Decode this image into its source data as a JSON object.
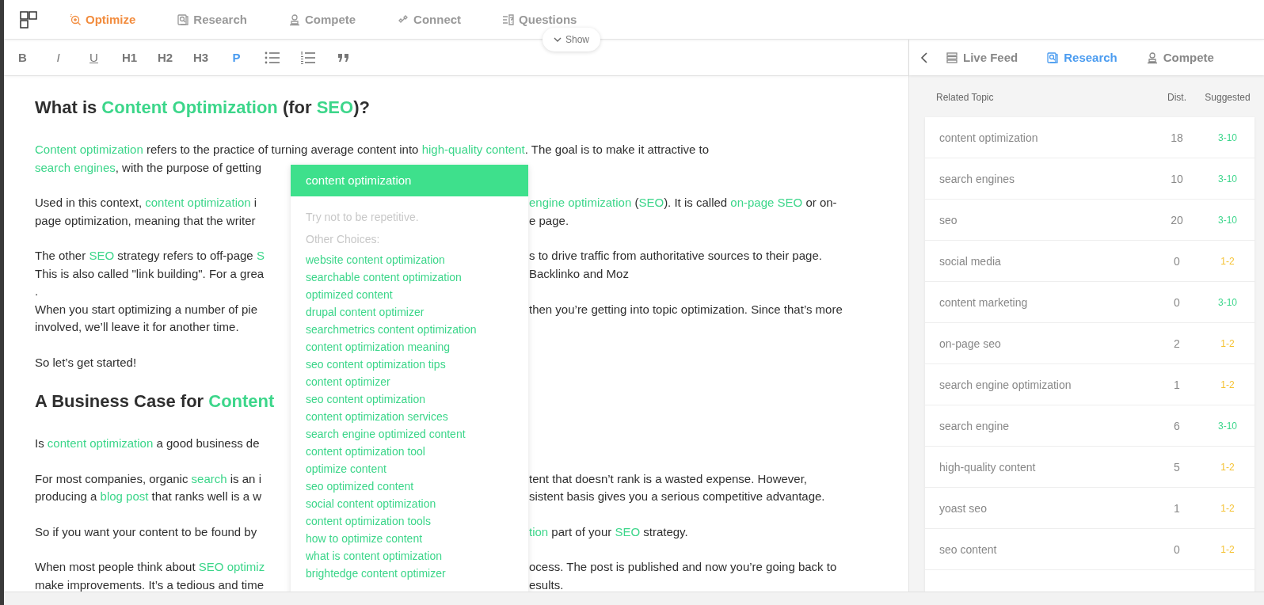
{
  "nav": {
    "tabs": [
      {
        "label": "Optimize",
        "selected": true
      },
      {
        "label": "Research",
        "selected": false
      },
      {
        "label": "Compete",
        "selected": false
      },
      {
        "label": "Connect",
        "selected": false
      },
      {
        "label": "Questions",
        "selected": false
      }
    ],
    "show_button": "Show"
  },
  "toolbar": [
    {
      "kind": "text",
      "label": "B",
      "selected": false
    },
    {
      "kind": "text",
      "label": "I",
      "selected": false
    },
    {
      "kind": "text",
      "label": "U",
      "selected": false
    },
    {
      "kind": "text",
      "label": "H1",
      "selected": false
    },
    {
      "kind": "text",
      "label": "H2",
      "selected": false
    },
    {
      "kind": "text",
      "label": "H3",
      "selected": false
    },
    {
      "kind": "text",
      "label": "P",
      "selected": true
    },
    {
      "kind": "bullets",
      "selected": false
    },
    {
      "kind": "numbers",
      "selected": false
    },
    {
      "kind": "quote",
      "selected": false
    }
  ],
  "editor": {
    "paragraphs": [
      {
        "kind": "heading",
        "lines": [
          {
            "left": [
              {
                "text": "What is ",
                "keyword": false
              },
              {
                "text": "Content Optimization",
                "keyword": true
              },
              {
                "text": " (for ",
                "keyword": false
              },
              {
                "text": "SEO",
                "keyword": true
              },
              {
                "text": ")?",
                "keyword": false
              }
            ]
          }
        ]
      },
      {
        "kind": "text",
        "lines": [
          {
            "left": [
              {
                "text": "Content optimization",
                "keyword": true
              },
              {
                "text": " refers to the practice of turning average content into ",
                "keyword": false
              },
              {
                "text": "high-quality content",
                "keyword": true
              },
              {
                "text": ". The goal is to make it attractive to",
                "keyword": false
              }
            ]
          },
          {
            "left": [
              {
                "text": "search engines",
                "keyword": true
              },
              {
                "text": ", with the purpose of getting",
                "keyword": false
              }
            ]
          }
        ]
      },
      {
        "kind": "text",
        "lines": [
          {
            "left": [
              {
                "text": "Used in this context, ",
                "keyword": false
              },
              {
                "text": "content optimization",
                "keyword": true
              },
              {
                "text": " i",
                "keyword": false
              }
            ],
            "right": [
              {
                "text": "engine optimization",
                "keyword": true
              },
              {
                "text": " (",
                "keyword": false
              },
              {
                "text": "SEO",
                "keyword": true
              },
              {
                "text": "). It is called ",
                "keyword": false
              },
              {
                "text": "on-page SEO",
                "keyword": true
              },
              {
                "text": " or on-",
                "keyword": false
              }
            ]
          },
          {
            "left": [
              {
                "text": "page optimization, meaning that the writer",
                "keyword": false
              }
            ],
            "right": [
              {
                "text": "e page.",
                "keyword": false
              }
            ]
          }
        ]
      },
      {
        "kind": "text",
        "lines": [
          {
            "left": [
              {
                "text": "The other ",
                "keyword": false
              },
              {
                "text": "SEO",
                "keyword": true
              },
              {
                "text": " strategy refers to off-page ",
                "keyword": false
              },
              {
                "text": "S",
                "keyword": true
              }
            ],
            "right": [
              {
                "text": "s to drive traffic from authoritative sources to their page.",
                "keyword": false
              }
            ]
          },
          {
            "left": [
              {
                "text": "This is also called \"link building\". For a grea",
                "keyword": false
              }
            ],
            "right": [
              {
                "text": "Backlinko and Moz",
                "keyword": false
              }
            ]
          },
          {
            "left": [
              {
                "text": ".",
                "keyword": false
              }
            ]
          },
          {
            "left": [
              {
                "text": "When you start optimizing a number of pie",
                "keyword": false
              }
            ],
            "right": [
              {
                "text": "then you’re getting into topic optimization. Since that’s more",
                "keyword": false
              }
            ]
          },
          {
            "left": [
              {
                "text": "involved, we’ll leave it for another time.",
                "keyword": false
              }
            ]
          }
        ]
      },
      {
        "kind": "text",
        "lines": [
          {
            "left": [
              {
                "text": "So let’s get started!",
                "keyword": false
              }
            ]
          }
        ]
      },
      {
        "kind": "heading",
        "lines": [
          {
            "left": [
              {
                "text": "A Business Case for ",
                "keyword": false
              },
              {
                "text": "Content",
                "keyword": true
              }
            ]
          }
        ]
      },
      {
        "kind": "text",
        "lines": [
          {
            "left": [
              {
                "text": "Is ",
                "keyword": false
              },
              {
                "text": "content optimization",
                "keyword": true
              },
              {
                "text": " a good business de",
                "keyword": false
              }
            ]
          }
        ]
      },
      {
        "kind": "text",
        "lines": [
          {
            "left": [
              {
                "text": "For most companies, organic ",
                "keyword": false
              },
              {
                "text": "search",
                "keyword": true
              },
              {
                "text": " is an i",
                "keyword": false
              }
            ],
            "right": [
              {
                "text": "tent that doesn’t rank is a wasted expense. However,",
                "keyword": false
              }
            ]
          },
          {
            "left": [
              {
                "text": "producing a ",
                "keyword": false
              },
              {
                "text": "blog post",
                "keyword": true
              },
              {
                "text": " that ranks well is a w",
                "keyword": false
              }
            ],
            "right": [
              {
                "text": "sistent basis gives you a serious competitive advantage.",
                "keyword": false
              }
            ]
          }
        ]
      },
      {
        "kind": "text",
        "lines": [
          {
            "left": [
              {
                "text": "So if you want your content to be found by",
                "keyword": false
              }
            ],
            "right": [
              {
                "text": "tion",
                "keyword": true
              },
              {
                "text": " part of your ",
                "keyword": false
              },
              {
                "text": "SEO",
                "keyword": true
              },
              {
                "text": " strategy.",
                "keyword": false
              }
            ]
          }
        ]
      },
      {
        "kind": "text",
        "lines": [
          {
            "left": [
              {
                "text": "When most people think about ",
                "keyword": false
              },
              {
                "text": "SEO optimiz",
                "keyword": true
              }
            ],
            "right": [
              {
                "text": "ocess. The post is published and now you’re going back to",
                "keyword": false
              }
            ]
          },
          {
            "left": [
              {
                "text": "make improvements. It’s a tedious and time",
                "keyword": false
              }
            ],
            "right": [
              {
                "text": "esults.",
                "keyword": false
              }
            ]
          }
        ]
      }
    ]
  },
  "popup": {
    "title": "content optimization",
    "hint": "Try not to be repetitive.",
    "choices_label": "Other Choices:",
    "choices": [
      "website content optimization",
      "searchable content optimization",
      "optimized content",
      "drupal content optimizer",
      "searchmetrics content optimization",
      "content optimization meaning",
      "seo content optimization tips",
      "content optimizer",
      "seo content optimization",
      "content optimization services",
      "search engine optimized content",
      "content optimization tool",
      "optimize content",
      "seo optimized content",
      "social content optimization",
      "content optimization tools",
      "how to optimize content",
      "what is content optimization",
      "brightedge content optimizer"
    ]
  },
  "panel": {
    "tabs": [
      {
        "label": "Live Feed",
        "selected": false
      },
      {
        "label": "Research",
        "selected": true
      },
      {
        "label": "Compete",
        "selected": false
      }
    ],
    "columns": [
      "Related Topic",
      "Dist.",
      "Suggested"
    ],
    "rows": [
      {
        "topic": "content optimization",
        "dist": "18",
        "suggested": "3-10",
        "color": "#3dd68c"
      },
      {
        "topic": "search engines",
        "dist": "10",
        "suggested": "3-10",
        "color": "#3dd68c"
      },
      {
        "topic": "seo",
        "dist": "20",
        "suggested": "3-10",
        "color": "#3dd68c"
      },
      {
        "topic": "social media",
        "dist": "0",
        "suggested": "1-2",
        "color": "#f5c232"
      },
      {
        "topic": "content marketing",
        "dist": "0",
        "suggested": "3-10",
        "color": "#3dd68c"
      },
      {
        "topic": "on-page seo",
        "dist": "2",
        "suggested": "1-2",
        "color": "#f5c232"
      },
      {
        "topic": "search engine optimization",
        "dist": "1",
        "suggested": "1-2",
        "color": "#f5c232"
      },
      {
        "topic": "search engine",
        "dist": "6",
        "suggested": "3-10",
        "color": "#3dd68c"
      },
      {
        "topic": "high-quality content",
        "dist": "5",
        "suggested": "1-2",
        "color": "#f5c232"
      },
      {
        "topic": "yoast seo",
        "dist": "1",
        "suggested": "1-2",
        "color": "#f5c232"
      },
      {
        "topic": "seo content",
        "dist": "0",
        "suggested": "1-2",
        "color": "#f5c232"
      }
    ]
  }
}
